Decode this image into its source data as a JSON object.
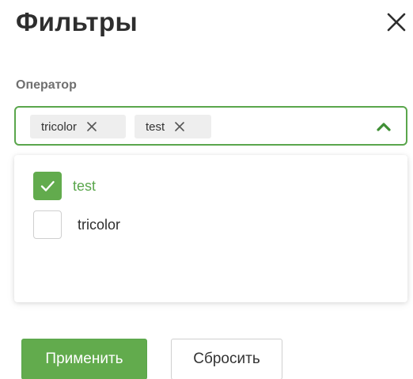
{
  "panel": {
    "title": "Фильтры"
  },
  "field": {
    "label": "Оператор"
  },
  "selected_chips": [
    {
      "label": "tricolor"
    },
    {
      "label": "test"
    }
  ],
  "options": [
    {
      "label": "test",
      "checked": true
    },
    {
      "label": "tricolor",
      "checked": false
    }
  ],
  "actions": {
    "apply_label": "Применить",
    "reset_label": "Сбросить"
  },
  "icons": {
    "close": "close-icon",
    "chip_remove": "x-icon",
    "dropdown_toggle": "chevron-up-icon",
    "checkmark": "check-icon"
  },
  "colors": {
    "accent": "#5aa64c",
    "chip_bg": "#eeeeee"
  }
}
